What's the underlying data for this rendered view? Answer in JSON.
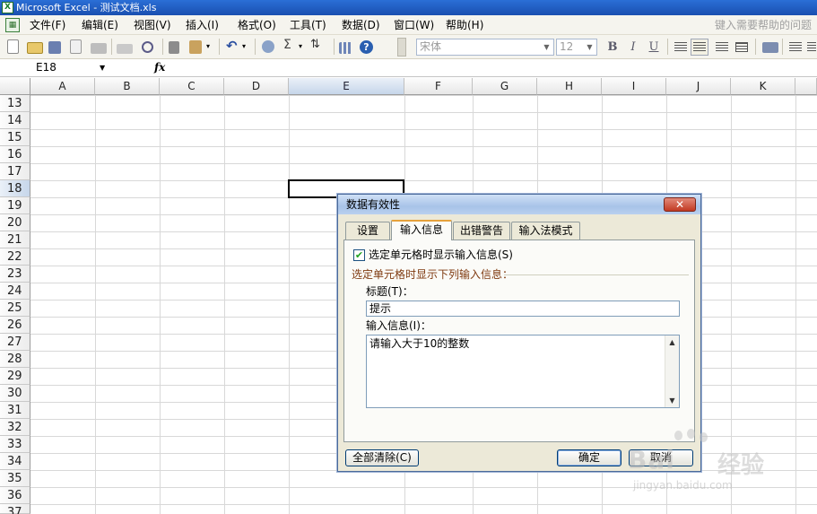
{
  "window": {
    "title": "Microsoft Excel - 测试文档.xls",
    "app_icon": "excel-icon"
  },
  "menu": {
    "items": [
      "文件(F)",
      "编辑(E)",
      "视图(V)",
      "插入(I)",
      "格式(O)",
      "工具(T)",
      "数据(D)",
      "窗口(W)",
      "帮助(H)"
    ],
    "help_placeholder": "键入需要帮助的问题"
  },
  "toolbar": {
    "font_name": "宋体",
    "font_size": "12",
    "bold_label": "B",
    "italic_label": "I",
    "underline_label": "U",
    "sum_label": "Σ"
  },
  "formula_bar": {
    "name_box": "E18",
    "fx_label": "fx",
    "value": ""
  },
  "sheet": {
    "columns": [
      "A",
      "B",
      "C",
      "D",
      "E",
      "F",
      "G",
      "H",
      "I",
      "J",
      "K"
    ],
    "rows": [
      "13",
      "14",
      "15",
      "16",
      "17",
      "18",
      "19",
      "20",
      "21",
      "22",
      "23",
      "24",
      "25",
      "26",
      "27",
      "28",
      "29",
      "30",
      "31",
      "32",
      "33",
      "34",
      "35",
      "36",
      "37"
    ],
    "selected_column": "E",
    "selected_row": "18"
  },
  "dialog": {
    "title": "数据有效性",
    "close_label": "✕",
    "tabs": [
      "设置",
      "输入信息",
      "出错警告",
      "输入法模式"
    ],
    "active_tab": "输入信息",
    "show_input_checkbox_label": "选定单元格时显示输入信息(S)",
    "show_input_checked": true,
    "group_label": "选定单元格时显示下列输入信息：",
    "title_field_label": "标题(T)：",
    "title_field_value": "提示",
    "message_field_label": "输入信息(I)：",
    "message_field_value": "请输入大于10的整数",
    "clear_all_button": "全部清除(C)",
    "ok_button": "确定",
    "cancel_button": "取消"
  },
  "watermark": {
    "brand": "Bai",
    "brand_cn": "经验",
    "url": "jingyan.baidu.com"
  }
}
